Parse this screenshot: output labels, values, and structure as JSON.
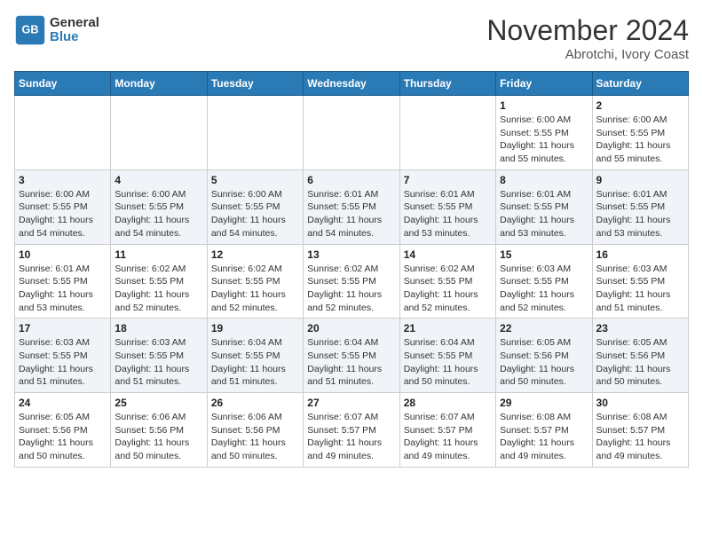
{
  "header": {
    "logo_line1": "General",
    "logo_line2": "Blue",
    "title": "November 2024",
    "subtitle": "Abrotchi, Ivory Coast"
  },
  "days_of_week": [
    "Sunday",
    "Monday",
    "Tuesday",
    "Wednesday",
    "Thursday",
    "Friday",
    "Saturday"
  ],
  "weeks": [
    [
      {
        "day": "",
        "info": ""
      },
      {
        "day": "",
        "info": ""
      },
      {
        "day": "",
        "info": ""
      },
      {
        "day": "",
        "info": ""
      },
      {
        "day": "",
        "info": ""
      },
      {
        "day": "1",
        "info": "Sunrise: 6:00 AM\nSunset: 5:55 PM\nDaylight: 11 hours\nand 55 minutes."
      },
      {
        "day": "2",
        "info": "Sunrise: 6:00 AM\nSunset: 5:55 PM\nDaylight: 11 hours\nand 55 minutes."
      }
    ],
    [
      {
        "day": "3",
        "info": "Sunrise: 6:00 AM\nSunset: 5:55 PM\nDaylight: 11 hours\nand 54 minutes."
      },
      {
        "day": "4",
        "info": "Sunrise: 6:00 AM\nSunset: 5:55 PM\nDaylight: 11 hours\nand 54 minutes."
      },
      {
        "day": "5",
        "info": "Sunrise: 6:00 AM\nSunset: 5:55 PM\nDaylight: 11 hours\nand 54 minutes."
      },
      {
        "day": "6",
        "info": "Sunrise: 6:01 AM\nSunset: 5:55 PM\nDaylight: 11 hours\nand 54 minutes."
      },
      {
        "day": "7",
        "info": "Sunrise: 6:01 AM\nSunset: 5:55 PM\nDaylight: 11 hours\nand 53 minutes."
      },
      {
        "day": "8",
        "info": "Sunrise: 6:01 AM\nSunset: 5:55 PM\nDaylight: 11 hours\nand 53 minutes."
      },
      {
        "day": "9",
        "info": "Sunrise: 6:01 AM\nSunset: 5:55 PM\nDaylight: 11 hours\nand 53 minutes."
      }
    ],
    [
      {
        "day": "10",
        "info": "Sunrise: 6:01 AM\nSunset: 5:55 PM\nDaylight: 11 hours\nand 53 minutes."
      },
      {
        "day": "11",
        "info": "Sunrise: 6:02 AM\nSunset: 5:55 PM\nDaylight: 11 hours\nand 52 minutes."
      },
      {
        "day": "12",
        "info": "Sunrise: 6:02 AM\nSunset: 5:55 PM\nDaylight: 11 hours\nand 52 minutes."
      },
      {
        "day": "13",
        "info": "Sunrise: 6:02 AM\nSunset: 5:55 PM\nDaylight: 11 hours\nand 52 minutes."
      },
      {
        "day": "14",
        "info": "Sunrise: 6:02 AM\nSunset: 5:55 PM\nDaylight: 11 hours\nand 52 minutes."
      },
      {
        "day": "15",
        "info": "Sunrise: 6:03 AM\nSunset: 5:55 PM\nDaylight: 11 hours\nand 52 minutes."
      },
      {
        "day": "16",
        "info": "Sunrise: 6:03 AM\nSunset: 5:55 PM\nDaylight: 11 hours\nand 51 minutes."
      }
    ],
    [
      {
        "day": "17",
        "info": "Sunrise: 6:03 AM\nSunset: 5:55 PM\nDaylight: 11 hours\nand 51 minutes."
      },
      {
        "day": "18",
        "info": "Sunrise: 6:03 AM\nSunset: 5:55 PM\nDaylight: 11 hours\nand 51 minutes."
      },
      {
        "day": "19",
        "info": "Sunrise: 6:04 AM\nSunset: 5:55 PM\nDaylight: 11 hours\nand 51 minutes."
      },
      {
        "day": "20",
        "info": "Sunrise: 6:04 AM\nSunset: 5:55 PM\nDaylight: 11 hours\nand 51 minutes."
      },
      {
        "day": "21",
        "info": "Sunrise: 6:04 AM\nSunset: 5:55 PM\nDaylight: 11 hours\nand 50 minutes."
      },
      {
        "day": "22",
        "info": "Sunrise: 6:05 AM\nSunset: 5:56 PM\nDaylight: 11 hours\nand 50 minutes."
      },
      {
        "day": "23",
        "info": "Sunrise: 6:05 AM\nSunset: 5:56 PM\nDaylight: 11 hours\nand 50 minutes."
      }
    ],
    [
      {
        "day": "24",
        "info": "Sunrise: 6:05 AM\nSunset: 5:56 PM\nDaylight: 11 hours\nand 50 minutes."
      },
      {
        "day": "25",
        "info": "Sunrise: 6:06 AM\nSunset: 5:56 PM\nDaylight: 11 hours\nand 50 minutes."
      },
      {
        "day": "26",
        "info": "Sunrise: 6:06 AM\nSunset: 5:56 PM\nDaylight: 11 hours\nand 50 minutes."
      },
      {
        "day": "27",
        "info": "Sunrise: 6:07 AM\nSunset: 5:57 PM\nDaylight: 11 hours\nand 49 minutes."
      },
      {
        "day": "28",
        "info": "Sunrise: 6:07 AM\nSunset: 5:57 PM\nDaylight: 11 hours\nand 49 minutes."
      },
      {
        "day": "29",
        "info": "Sunrise: 6:08 AM\nSunset: 5:57 PM\nDaylight: 11 hours\nand 49 minutes."
      },
      {
        "day": "30",
        "info": "Sunrise: 6:08 AM\nSunset: 5:57 PM\nDaylight: 11 hours\nand 49 minutes."
      }
    ]
  ]
}
